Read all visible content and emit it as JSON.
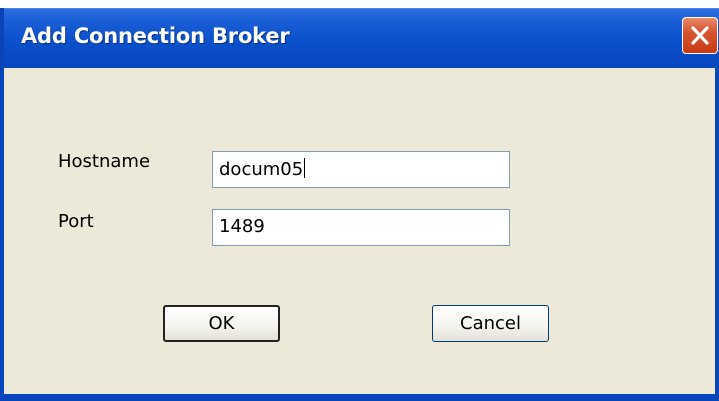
{
  "dialog": {
    "title": "Add Connection Broker",
    "close_icon": "close-x-icon"
  },
  "form": {
    "hostname_label": "Hostname",
    "hostname_value": "docum05",
    "port_label": "Port",
    "port_value": "1489"
  },
  "buttons": {
    "ok_label": "OK",
    "cancel_label": "Cancel"
  },
  "colors": {
    "titlebar": "#0a4fcb",
    "close_button": "#d6552e",
    "client_background": "#ece9d8"
  }
}
